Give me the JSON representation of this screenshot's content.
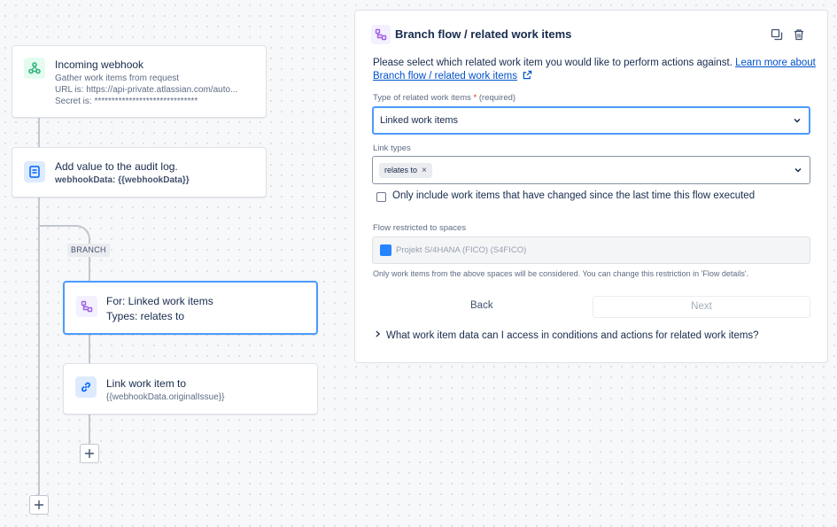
{
  "flow": {
    "trigger": {
      "title": "Incoming webhook",
      "lines": [
        "Gather work items from request",
        "URL is: https://api-private.atlassian.com/auto...",
        "Secret is: ******************************"
      ]
    },
    "audit_action": {
      "title": "Add value to the audit log.",
      "detail": "webhookData: {{webhookData}}"
    },
    "branch_label": "BRANCH",
    "branch_node": {
      "title": "For: Linked work items",
      "detail": "Types: relates to"
    },
    "link_action": {
      "title": "Link work item to",
      "detail": "{{webhookData.originalIssue}}"
    }
  },
  "panel": {
    "title": "Branch flow / related work items",
    "intro_text": "Please select which related work item you would like to perform actions against. ",
    "intro_link": "Learn more about Branch flow / related work items",
    "type_label": "Type of related work items",
    "type_required_mark": "*",
    "type_required_text": "(required)",
    "type_value": "Linked work items",
    "link_types_label": "Link types",
    "link_types_tag": "relates to",
    "tag_remove_glyph": "×",
    "checkbox_label": "Only include work items that have changed since the last time this flow executed",
    "restricted_label": "Flow restricted to spaces",
    "restricted_value": "Projekt S/4HANA (FICO) (S4FICO)",
    "restricted_help": "Only work items from the above spaces will be considered. You can change this restriction in 'Flow details'.",
    "back_label": "Back",
    "next_label": "Next",
    "faq_text": "What work item data can I access in conditions and actions for related work items?"
  },
  "colors": {
    "accent": "#4c9aff",
    "link": "#0052cc",
    "branch_icon": "#a05ee0",
    "webhook_icon": "#36b37e",
    "audit_icon": "#0065ff",
    "required": "#de350b"
  }
}
